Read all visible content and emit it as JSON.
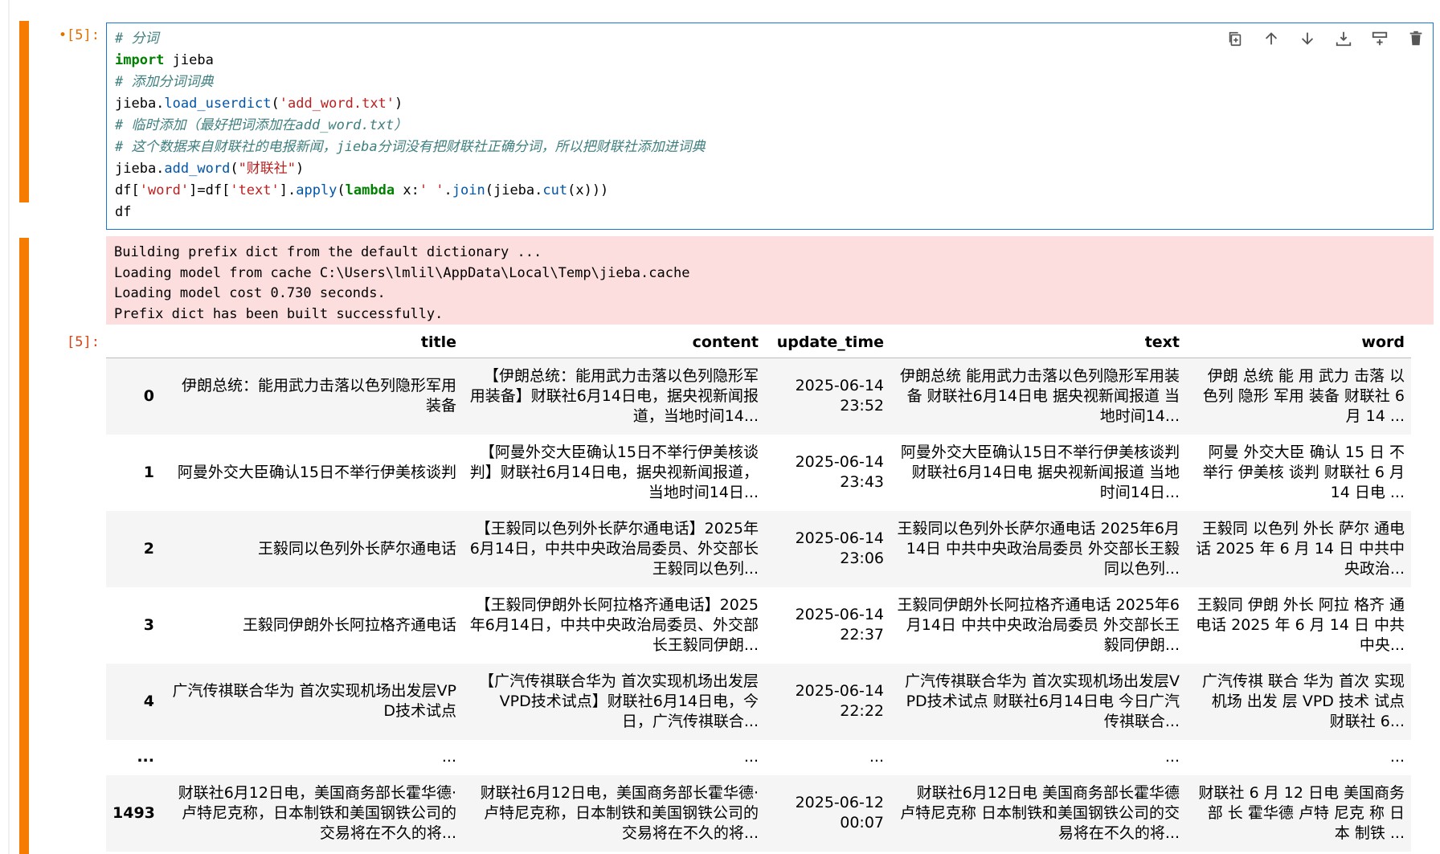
{
  "cell_in": {
    "prompt": "•[5]:",
    "code_lines": [
      [
        {
          "t": "c",
          "v": "# 分词"
        }
      ],
      [
        {
          "t": "k",
          "v": "import"
        },
        {
          "t": "n",
          "v": " jieba"
        }
      ],
      [
        {
          "t": "c",
          "v": "# 添加分词词典"
        }
      ],
      [
        {
          "t": "n",
          "v": "jieba."
        },
        {
          "t": "f",
          "v": "load_userdict"
        },
        {
          "t": "n",
          "v": "("
        },
        {
          "t": "s",
          "v": "'add_word.txt'"
        },
        {
          "t": "n",
          "v": ")"
        }
      ],
      [
        {
          "t": "c",
          "v": "# 临时添加（最好把词添加在add_word.txt）"
        }
      ],
      [
        {
          "t": "c",
          "v": "# 这个数据来自财联社的电报新闻，jieba分词没有把财联社正确分词，所以把财联社添加进词典"
        }
      ],
      [
        {
          "t": "n",
          "v": "jieba."
        },
        {
          "t": "f",
          "v": "add_word"
        },
        {
          "t": "n",
          "v": "("
        },
        {
          "t": "s",
          "v": "\"财联社\""
        },
        {
          "t": "n",
          "v": ")"
        }
      ],
      [
        {
          "t": "n",
          "v": "df["
        },
        {
          "t": "s",
          "v": "'word'"
        },
        {
          "t": "n",
          "v": "]=df["
        },
        {
          "t": "s",
          "v": "'text'"
        },
        {
          "t": "n",
          "v": "]."
        },
        {
          "t": "f",
          "v": "apply"
        },
        {
          "t": "n",
          "v": "("
        },
        {
          "t": "k",
          "v": "lambda"
        },
        {
          "t": "n",
          "v": " x:"
        },
        {
          "t": "s",
          "v": "' '"
        },
        {
          "t": "n",
          "v": "."
        },
        {
          "t": "f",
          "v": "join"
        },
        {
          "t": "n",
          "v": "(jieba."
        },
        {
          "t": "f",
          "v": "cut"
        },
        {
          "t": "n",
          "v": "(x)))"
        }
      ],
      [
        {
          "t": "n",
          "v": "df"
        }
      ]
    ]
  },
  "toolbar_icons": [
    "duplicate-cell-icon",
    "move-up-icon",
    "move-down-icon",
    "insert-below-icon",
    "insert-above-icon",
    "delete-cell-icon"
  ],
  "stderr_lines": [
    "Building prefix dict from the default dictionary ...",
    "Loading model from cache C:\\Users\\lmlil\\AppData\\Local\\Temp\\jieba.cache",
    "Loading model cost 0.730 seconds.",
    "Prefix dict has been built successfully."
  ],
  "cell_out": {
    "prompt": "[5]:"
  },
  "table": {
    "columns": [
      "",
      "title",
      "content",
      "update_time",
      "text",
      "word"
    ],
    "rows": [
      [
        "0",
        "伊朗总统：能用武力击落以色列隐形军用装备",
        "【伊朗总统：能用武力击落以色列隐形军用装备】财联社6月14日电，据央视新闻报道，当地时间14...",
        "2025-06-14 23:52",
        "伊朗总统 能用武力击落以色列隐形军用装备 财联社6月14日电 据央视新闻报道 当地时间14...",
        "伊朗 总统 能 用 武力 击落 以色列 隐形 军用 装备 财联社 6 月 14 ..."
      ],
      [
        "1",
        "阿曼外交大臣确认15日不举行伊美核谈判",
        "【阿曼外交大臣确认15日不举行伊美核谈判】财联社6月14日电，据央视新闻报道，当地时间14日...",
        "2025-06-14 23:43",
        "阿曼外交大臣确认15日不举行伊美核谈判 财联社6月14日电 据央视新闻报道 当地时间14日...",
        "阿曼 外交大臣 确认 15 日 不 举行 伊美核 谈判 财联社 6 月 14 日电 ..."
      ],
      [
        "2",
        "王毅同以色列外长萨尔通电话",
        "【王毅同以色列外长萨尔通电话】2025年6月14日，中共中央政治局委员、外交部长王毅同以色列...",
        "2025-06-14 23:06",
        "王毅同以色列外长萨尔通电话 2025年6月14日 中共中央政治局委员 外交部长王毅同以色列...",
        "王毅同 以色列 外长 萨尔 通电话 2025 年 6 月 14 日 中共中央政治..."
      ],
      [
        "3",
        "王毅同伊朗外长阿拉格齐通电话",
        "【王毅同伊朗外长阿拉格齐通电话】2025年6月14日，中共中央政治局委员、外交部长王毅同伊朗...",
        "2025-06-14 22:37",
        "王毅同伊朗外长阿拉格齐通电话 2025年6月14日 中共中央政治局委员 外交部长王毅同伊朗...",
        "王毅同 伊朗 外长 阿拉 格齐 通电话 2025 年 6 月 14 日 中共中央..."
      ],
      [
        "4",
        "广汽传祺联合华为 首次实现机场出发层VPD技术试点",
        "【广汽传祺联合华为 首次实现机场出发层VPD技术试点】财联社6月14日电，今日，广汽传祺联合...",
        "2025-06-14 22:22",
        "广汽传祺联合华为 首次实现机场出发层VPD技术试点 财联社6月14日电 今日广汽传祺联合...",
        "广汽传祺 联合 华为 首次 实现 机场 出发 层 VPD 技术 试点 财联社 6..."
      ],
      [
        "...",
        "...",
        "...",
        "...",
        "...",
        "..."
      ],
      [
        "1493",
        "财联社6月12日电，美国商务部长霍华德·卢特尼克称，日本制铁和美国钢铁公司的交易将在不久的将...",
        "财联社6月12日电，美国商务部长霍华德·卢特尼克称，日本制铁和美国钢铁公司的交易将在不久的将...",
        "2025-06-12 00:07",
        "财联社6月12日电 美国商务部长霍华德 卢特尼克称 日本制铁和美国钢铁公司的交易将在不久的将...",
        "财联社 6 月 12 日电 美国商务 部 长 霍华德 卢特 尼克 称 日本 制铁 ..."
      ]
    ]
  },
  "colors": {
    "cell_bar": "#f57c00",
    "editor_border": "#1976d2",
    "stderr_bg": "#fddede"
  }
}
